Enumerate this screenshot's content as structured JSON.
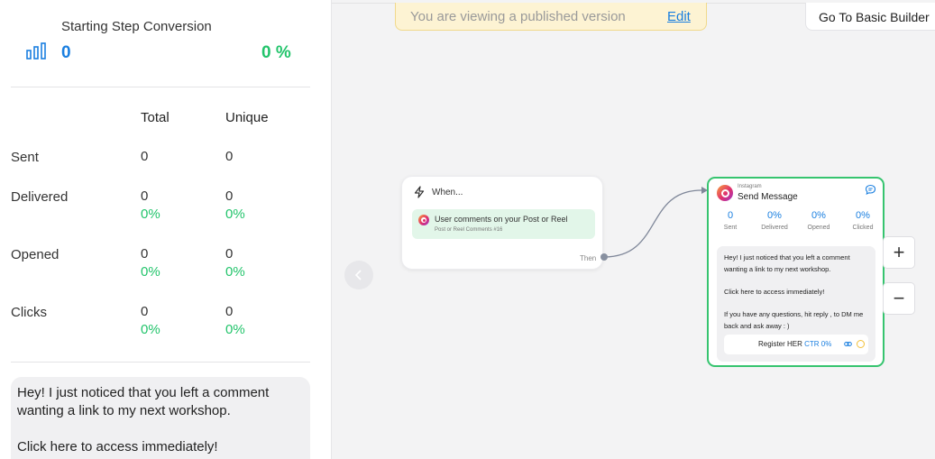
{
  "conversion": {
    "title": "Starting Step Conversion",
    "value": "0",
    "percent": "0 %"
  },
  "stats_table": {
    "headers": {
      "total": "Total",
      "unique": "Unique"
    },
    "rows": [
      {
        "label": "Sent",
        "total": "0",
        "unique": "0"
      },
      {
        "label": "Delivered",
        "total": "0",
        "total_pct": "0%",
        "unique": "0",
        "unique_pct": "0%"
      },
      {
        "label": "Opened",
        "total": "0",
        "total_pct": "0%",
        "unique": "0",
        "unique_pct": "0%"
      },
      {
        "label": "Clicks",
        "total": "0",
        "total_pct": "0%",
        "unique": "0",
        "unique_pct": "0%"
      }
    ]
  },
  "message_preview": "Hey! I just noticed that you left a comment wanting a link to my next workshop.\n\nClick here to access immediately!",
  "banner": {
    "text": "You are viewing a published version",
    "edit_link": "Edit"
  },
  "basic_builder_button": "Go To Basic Builder",
  "trigger_node": {
    "heading": "When...",
    "condition": "User comments on your Post or Reel",
    "condition_sub": "Post or Reel Comments #16",
    "then_label": "Then"
  },
  "message_node": {
    "platform": "Instagram",
    "title": "Send Message",
    "stats": [
      {
        "value": "0",
        "label": "Sent"
      },
      {
        "value": "0%",
        "label": "Delivered"
      },
      {
        "value": "0%",
        "label": "Opened"
      },
      {
        "value": "0%",
        "label": "Clicked"
      }
    ],
    "body": "Hey! I just noticed that you left a comment wanting a link to my next workshop.\n\nClick here to access immediately!\n\nIf you have any questions, hit reply , to DM me back and ask away : )",
    "button_label": "Register HER",
    "button_ctr": "CTR 0%"
  },
  "zoom_controls": {
    "zoom_in": "+",
    "zoom_out": "−"
  },
  "colors": {
    "accent_blue": "#1a7fe0",
    "success_green": "#22c46b",
    "node_border": "#36c46f",
    "banner_bg": "#fdf3d3"
  },
  "icons": [
    "bar-chart-icon",
    "lightning-icon",
    "instagram-icon",
    "chat-icon",
    "link-icon",
    "chevron-left-icon"
  ]
}
